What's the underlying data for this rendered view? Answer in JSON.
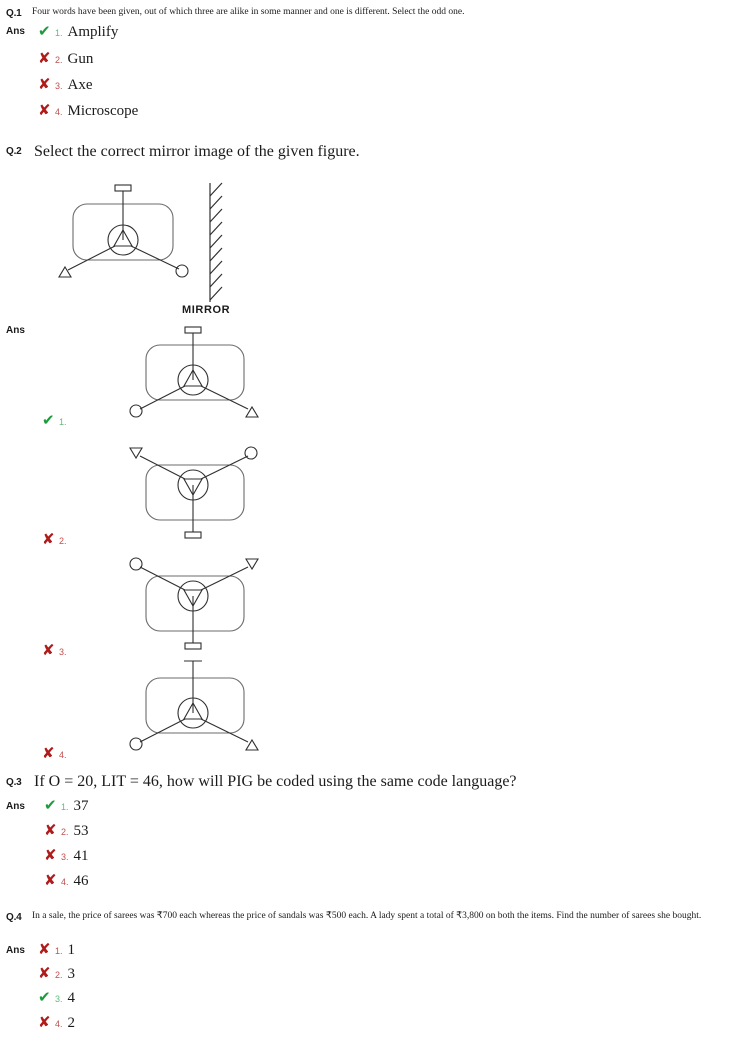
{
  "page": {
    "background": "#ffffff",
    "correct_color": "#1d9b3c",
    "wrong_color": "#b01b1b",
    "figure_stroke": "#5a5a5a",
    "figure_stroke_dark": "#2b2b2b"
  },
  "labels": {
    "ans": "Ans",
    "mirror": "MIRROR",
    "check_glyph": "✔",
    "cross_glyph": "✘"
  },
  "questions": [
    {
      "number": "Q.1",
      "text": "Four words have been given, out of which three are alike in some manner and one is different. Select the odd one.",
      "options": [
        {
          "num": "1.",
          "text": "Amplify",
          "correct": true
        },
        {
          "num": "2.",
          "text": "Gun",
          "correct": false
        },
        {
          "num": "3.",
          "text": "Axe",
          "correct": false
        },
        {
          "num": "4.",
          "text": "Microscope",
          "correct": false
        }
      ]
    },
    {
      "number": "Q.2",
      "text": "Select the correct mirror image of the given figure.",
      "options": [
        {
          "num": "1.",
          "correct": true
        },
        {
          "num": "2.",
          "correct": false
        },
        {
          "num": "3.",
          "correct": false
        },
        {
          "num": "4.",
          "correct": false
        }
      ]
    },
    {
      "number": "Q.3",
      "text": "If O = 20, LIT = 46, how will PIG be coded using the same code language?",
      "options": [
        {
          "num": "1.",
          "text": "37",
          "correct": true
        },
        {
          "num": "2.",
          "text": "53",
          "correct": false
        },
        {
          "num": "3.",
          "text": "41",
          "correct": false
        },
        {
          "num": "4.",
          "text": "46",
          "correct": false
        }
      ]
    },
    {
      "number": "Q.4",
      "text": "In a sale, the price of sarees was ₹700 each whereas the price of sandals was ₹500 each. A lady spent a total of  ₹3,800 on both the items. Find the number of sarees she bought.",
      "options": [
        {
          "num": "1.",
          "text": "1",
          "correct": false
        },
        {
          "num": "2.",
          "text": "3",
          "correct": false
        },
        {
          "num": "3.",
          "text": "4",
          "correct": true
        },
        {
          "num": "4.",
          "text": "2",
          "correct": false
        }
      ]
    }
  ]
}
